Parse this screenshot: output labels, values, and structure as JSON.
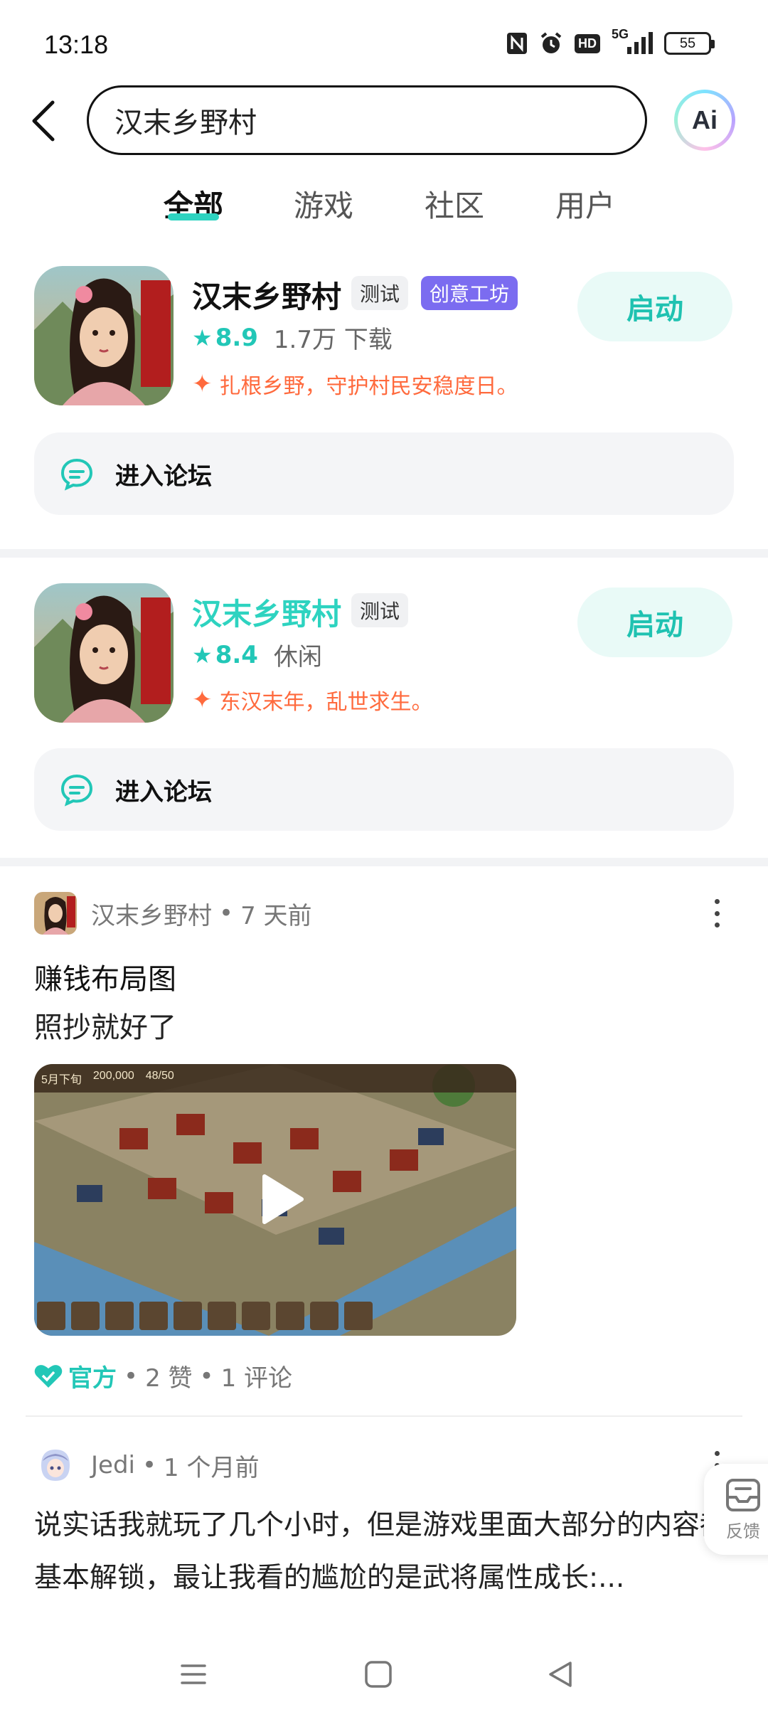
{
  "status_bar": {
    "time": "13:18",
    "network_label": "5G",
    "hd_label": "HD",
    "battery": "55"
  },
  "search": {
    "query": "汉末乡野村",
    "ai_label": "Ai"
  },
  "tabs": [
    {
      "label": "全部",
      "active": true
    },
    {
      "label": "游戏",
      "active": false
    },
    {
      "label": "社区",
      "active": false
    },
    {
      "label": "用户",
      "active": false
    }
  ],
  "games": [
    {
      "name": "汉末乡野村",
      "tag_test": "测试",
      "tag_workshop": "创意工坊",
      "score": "8.9",
      "meta": "1.7万 下载",
      "desc": "扎根乡野，守护村民安稳度日。",
      "launch_label": "启动",
      "forum_label": "进入论坛"
    },
    {
      "name": "汉末乡野村",
      "tag_test": "测试",
      "score": "8.4",
      "meta": "休闲",
      "desc": "东汉末年，乱世求生。",
      "launch_label": "启动",
      "forum_label": "进入论坛"
    }
  ],
  "posts": [
    {
      "author": "汉末乡野村",
      "time": "7 天前",
      "title": "赚钱布局图",
      "body": "照抄就好了",
      "video_hud": {
        "date": "5月下旬",
        "money": "200,000",
        "pop": "48/50"
      },
      "official": "官方",
      "likes": "2 赞",
      "comments": "1 评论"
    },
    {
      "author": "Jedi",
      "time": "1 个月前",
      "body": "说实话我就玩了几个小时，但是游戏里面大部分的内容都基本解锁，最让我看的尴尬的是武将属性成长:..."
    }
  ],
  "feedback_label": "反馈",
  "dot": "•",
  "colors": {
    "accent": "#2ed3c0",
    "workshop": "#7b6cf0",
    "desc": "#ff6a3d"
  }
}
